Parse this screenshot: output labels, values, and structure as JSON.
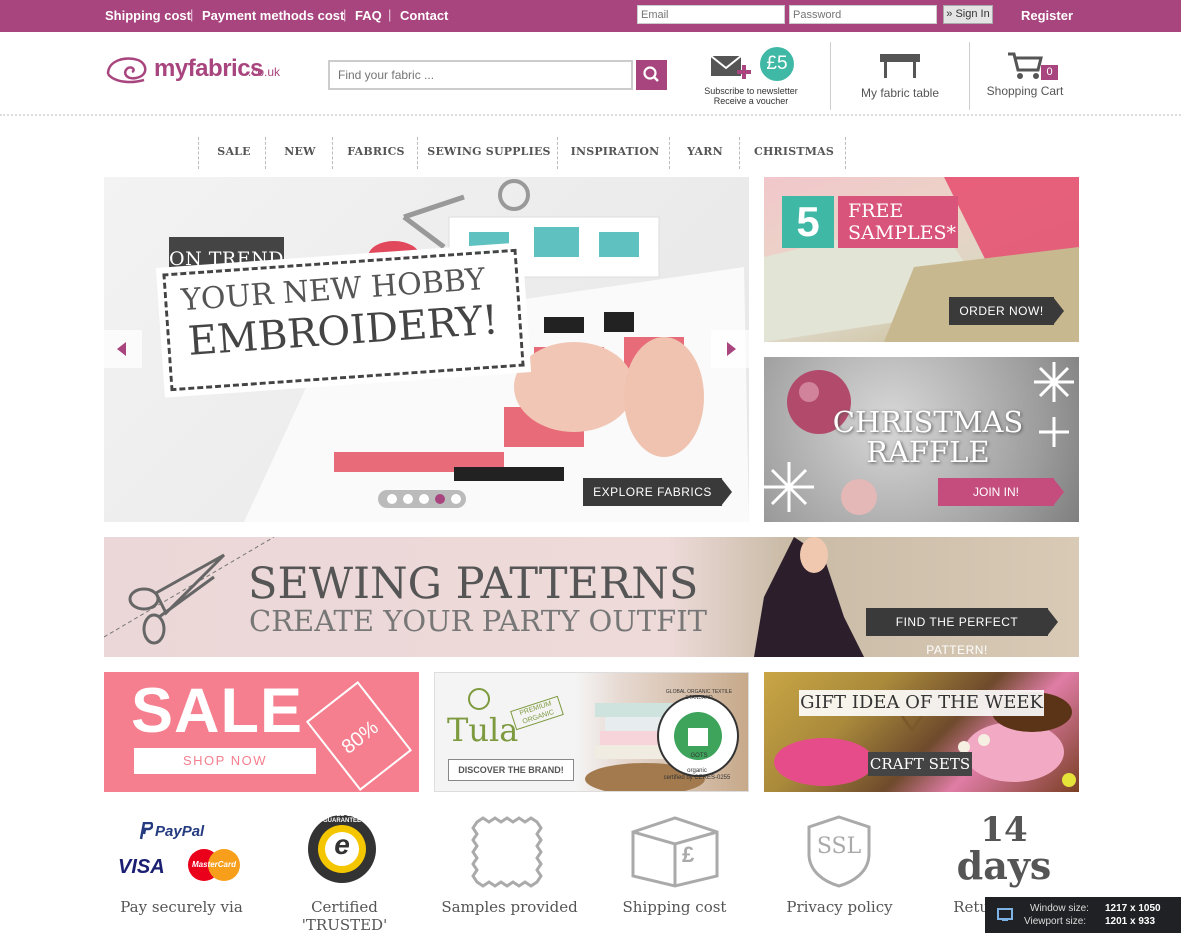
{
  "topbar": {
    "links": [
      "Shipping cost",
      "Payment methods cost",
      "FAQ",
      "Contact"
    ],
    "email_placeholder": "Email",
    "password_placeholder": "Password",
    "signin_label": "» Sign In",
    "register_label": "Register"
  },
  "header": {
    "logo_text": "myfabrics",
    "logo_domain": ".co.uk",
    "search_placeholder": "Find your fabric ...",
    "newsletter_line1": "Subscribe to newsletter",
    "newsletter_line2": "Receive a voucher",
    "voucher_amount": "£5",
    "fabric_table_label": "My fabric table",
    "cart_label": "Shopping Cart",
    "cart_count": "0"
  },
  "nav": [
    "SALE",
    "NEW",
    "FABRICS",
    "SEWING SUPPLIES",
    "INSPIRATION",
    "YARN",
    "CHRISTMAS"
  ],
  "slider": {
    "tag": "ON TREND",
    "line1": "YOUR NEW HOBBY",
    "line2": "EMBROIDERY!",
    "button": "EXPLORE FABRICS",
    "dots": 5,
    "active_dot": 4
  },
  "samples_banner": {
    "number": "5",
    "line1": "FREE",
    "line2": "SAMPLES*",
    "button": "ORDER NOW!"
  },
  "raffle_banner": {
    "line1": "CHRISTMAS",
    "line2": "RAFFLE",
    "button": "JOIN IN!"
  },
  "patterns_banner": {
    "line1": "SEWING PATTERNS",
    "line2": "CREATE YOUR PARTY OUTFIT",
    "button": "FIND THE PERFECT PATTERN!"
  },
  "sale_banner": {
    "title": "SALE",
    "tag": "80%",
    "button": "SHOP NOW"
  },
  "tula_banner": {
    "brand": "Tula",
    "badge1": "PREMIUM",
    "badge2": "ORGANIC",
    "button": "DISCOVER THE BRAND!",
    "gots": "GLOBAL ORGANIC TEXTILE STANDARD",
    "gots_short": "GOTS",
    "cert1": "organic",
    "cert2": "certified by CERES-0255"
  },
  "gift_banner": {
    "title": "GIFT IDEA OF THE WEEK",
    "subtitle": "CRAFT SETS"
  },
  "footer": {
    "paypal": "PayPal",
    "visa": "VISA",
    "mastercard": "MasterCard",
    "trusted_ring": "TRUSTED SHOPS GUARANTEE",
    "trusted_e": "e",
    "ssl": "SSL",
    "pound": "£",
    "days_num": "14",
    "days_word": "days",
    "labels": [
      "Pay securely via",
      "Certified 'TRUSTED'",
      "Samples provided",
      "Shipping cost",
      "Privacy policy",
      "Return policy"
    ]
  },
  "window_info": {
    "window_label": "Window size:",
    "window_value": "1217 x 1050",
    "viewport_label": "Viewport size:",
    "viewport_value": "1201 x 933"
  }
}
